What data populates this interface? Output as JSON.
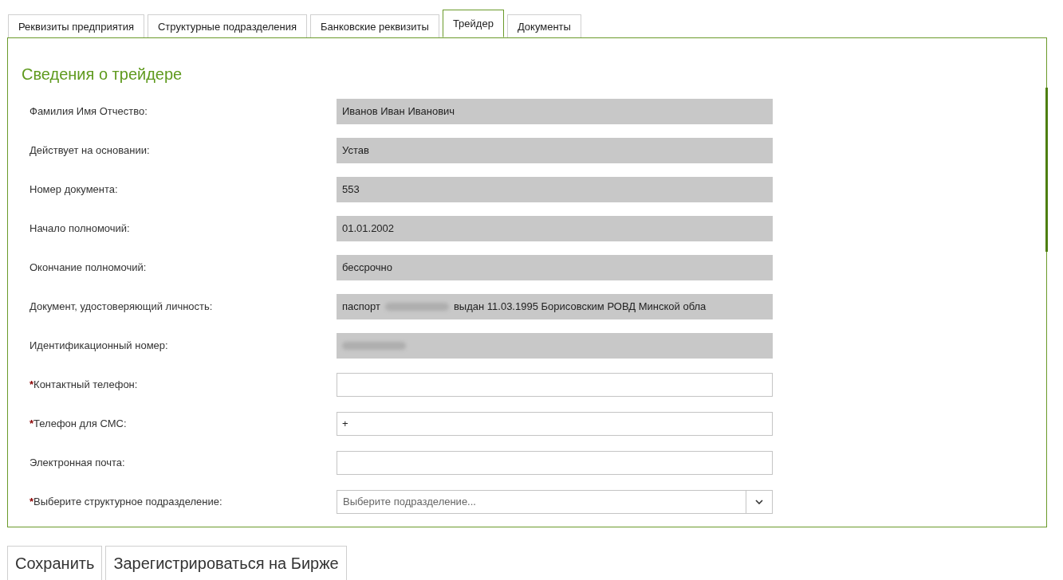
{
  "tabs": [
    {
      "label": "Реквизиты предприятия",
      "selected": false
    },
    {
      "label": "Структурные подразделения",
      "selected": false
    },
    {
      "label": "Банковские реквизиты",
      "selected": false
    },
    {
      "label": "Трейдер",
      "selected": true
    },
    {
      "label": "Документы",
      "selected": false
    }
  ],
  "section_title": "Сведения о трейдере",
  "required_mark": "*",
  "fields": [
    {
      "label": "Фамилия Имя Отчество:",
      "kind": "readonly",
      "required": false,
      "segments": [
        {
          "kind": "text",
          "text": "Иванов Иван Иванович"
        }
      ]
    },
    {
      "label": "Действует на основании:",
      "kind": "readonly",
      "required": false,
      "segments": [
        {
          "kind": "text",
          "text": "Устав"
        }
      ]
    },
    {
      "label": "Номер документа:",
      "kind": "readonly",
      "required": false,
      "segments": [
        {
          "kind": "text",
          "text": "553"
        }
      ]
    },
    {
      "label": "Начало полномочий:",
      "kind": "readonly",
      "required": false,
      "segments": [
        {
          "kind": "text",
          "text": "01.01.2002"
        }
      ]
    },
    {
      "label": "Окончание полномочий:",
      "kind": "readonly",
      "required": false,
      "segments": [
        {
          "kind": "text",
          "text": "бессрочно"
        }
      ]
    },
    {
      "label": "Документ, удостоверяющий личность:",
      "kind": "readonly",
      "required": false,
      "segments": [
        {
          "kind": "text",
          "text": "паспорт"
        },
        {
          "kind": "redacted"
        },
        {
          "kind": "text",
          "text": "выдан 11.03.1995 Борисовским РОВД Минской обла"
        }
      ]
    },
    {
      "label": "Идентификационный номер:",
      "kind": "readonly",
      "required": false,
      "segments": [
        {
          "kind": "redacted"
        }
      ]
    },
    {
      "label": "Контактный телефон:",
      "kind": "input",
      "required": true
    },
    {
      "label": "Телефон для СМС:",
      "kind": "input",
      "required": true,
      "value": "+"
    },
    {
      "label": "Электронная почта:",
      "kind": "input",
      "required": false
    },
    {
      "label": "Выберите структурное подразделение:",
      "kind": "select",
      "required": true,
      "placeholder": "Выберите подразделение..."
    }
  ],
  "buttons": [
    "Сохранить",
    "Зарегистрироваться на Бирже"
  ]
}
